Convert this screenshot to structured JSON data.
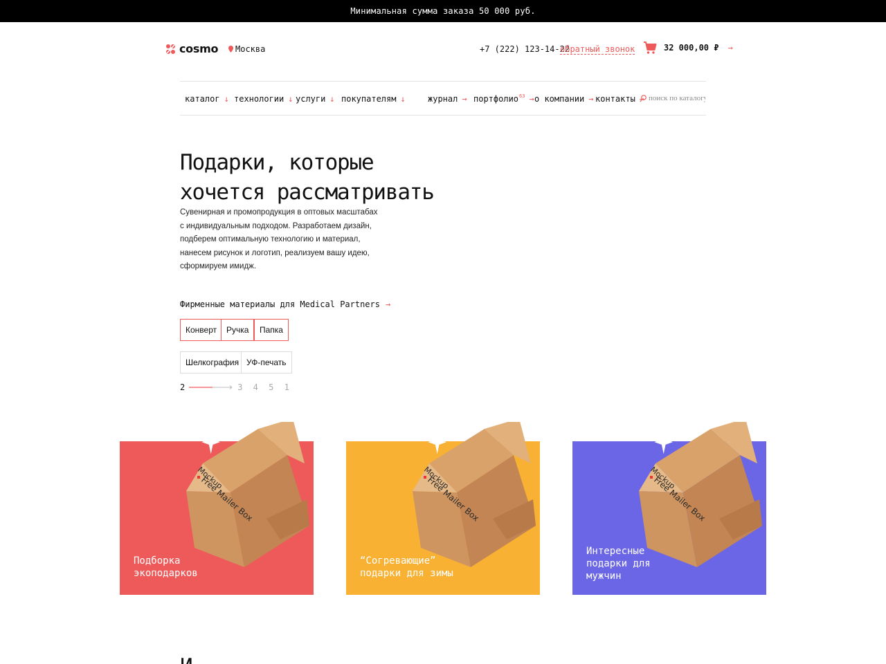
{
  "topbar": {
    "text": "Минимальная сумма заказа 50 000 руб."
  },
  "header": {
    "logo_text": "cosmo",
    "city": "Москва",
    "phone": "+7 (222) 123-14-22",
    "callback": "обратный звонок",
    "cart_total": "32 000,00 ₽",
    "arrow": "→"
  },
  "nav": {
    "items": [
      {
        "label": "каталог",
        "arrow": "↓"
      },
      {
        "label": "технологии",
        "arrow": "↓"
      },
      {
        "label": "услуги",
        "arrow": "↓"
      },
      {
        "label": "покупателям",
        "arrow": "↓"
      },
      {
        "label": "журнал",
        "arrow": "→"
      },
      {
        "label": "портфолио",
        "badge": "63",
        "arrow": "→"
      },
      {
        "label": "о компании",
        "arrow": "→"
      },
      {
        "label": "контакты",
        "arrow": "→"
      }
    ],
    "search_placeholder": "поиск по каталогу"
  },
  "hero": {
    "title_line1": "Подарки, которые",
    "title_line2": "хочется рассматривать",
    "description": "Сувенирная и промопродукция в оптовых масштабах с индивидуальным подходом. Разработаем дизайн, подберем оптимальную технологию и материал, нанесем рисунок и логотип, реализуем вашу идею, сформируем имидж."
  },
  "featured": {
    "title": "Фирменные материалы для Medical Partners",
    "arrow": "→",
    "tags": [
      "Конверт",
      "Ручка",
      "Папка",
      "Шелкография",
      "УФ-печать"
    ]
  },
  "pager": {
    "current": "2",
    "others": "3 4 5 1"
  },
  "cards": [
    {
      "line1": "Подборка",
      "line2": "экоподарков",
      "line3": "",
      "color": "#ee5a5a"
    },
    {
      "line1": "“Согревающие”",
      "line2": "подарки для зимы",
      "line3": "",
      "color": "#f8b133"
    },
    {
      "line1": "Интересные",
      "line2": "подарки для",
      "line3": "мужчин",
      "color": "#6b66e6"
    }
  ],
  "colors": {
    "accent": "#ee5a5a",
    "black": "#000000"
  },
  "icons": [
    "logo-icon",
    "location-pin-icon",
    "cart-icon",
    "search-icon",
    "sparkle-icon"
  ],
  "bottom": {
    "heading_start": "И"
  }
}
